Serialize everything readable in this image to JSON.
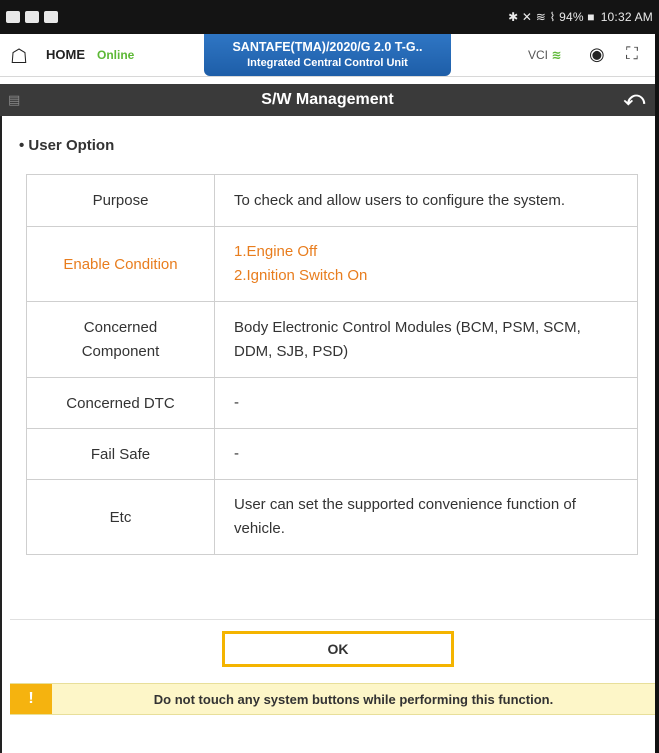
{
  "statusbar": {
    "indicators": "✱ ✕ ≋ ⌇ 94% ■",
    "time": "10:32 AM"
  },
  "header": {
    "home_label": "HOME",
    "online_label": "Online",
    "vehicle": "SANTAFE(TMA)/2020/G 2.0 T-G..",
    "system": "Integrated Central Control Unit",
    "vci_label": "VCI",
    "vci_wifi": "≋"
  },
  "titlebar": {
    "title": "S/W Management"
  },
  "section_title": "• User Option",
  "table": {
    "rows": [
      {
        "label": "Purpose",
        "value": "To check and allow users to configure the system."
      },
      {
        "label": "Enable Condition",
        "value_lines": [
          "1.Engine Off",
          "2.Ignition Switch On"
        ]
      },
      {
        "label_lines": [
          "Concerned",
          "Component"
        ],
        "value": "Body Electronic Control Modules (BCM, PSM, SCM, DDM, SJB, PSD)"
      },
      {
        "label": "Concerned DTC",
        "value": "-"
      },
      {
        "label": "Fail Safe",
        "value": "-"
      },
      {
        "label": "Etc",
        "value": "User can set the supported convenience function of vehicle."
      }
    ]
  },
  "ok_label": "OK",
  "warning": {
    "icon": "!",
    "text": "Do not touch any system buttons while performing this function."
  },
  "colors": {
    "highlight": "#e87d1e",
    "online": "#5db836",
    "tab_blue": "#2f76c4",
    "ok_border": "#f4b400",
    "warning_bg": "#fdf6c8"
  }
}
